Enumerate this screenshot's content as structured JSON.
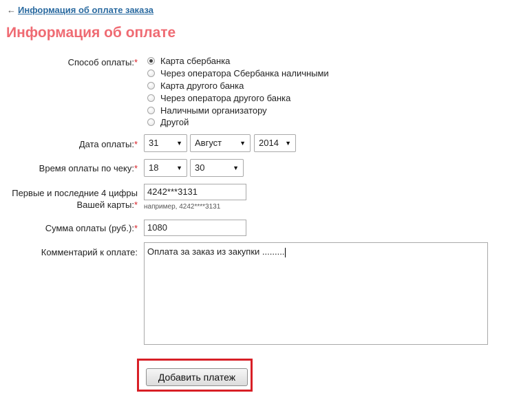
{
  "back_link": {
    "arrow": "←",
    "label": "Информация об оплате заказа"
  },
  "page_title": "Информация об оплате",
  "required_mark": "*",
  "payment_method": {
    "label": "Способ оплаты:",
    "options": [
      {
        "label": "Карта сбербанка",
        "checked": true
      },
      {
        "label": "Через оператора Сбербанка наличными",
        "checked": false
      },
      {
        "label": "Карта другого банка",
        "checked": false
      },
      {
        "label": "Через оператора другого банка",
        "checked": false
      },
      {
        "label": "Наличными организатору",
        "checked": false
      },
      {
        "label": "Другой",
        "checked": false
      }
    ]
  },
  "payment_date": {
    "label": "Дата оплаты:",
    "day": "31",
    "month": "Август",
    "year": "2014"
  },
  "payment_time": {
    "label": "Время оплаты по чеку:",
    "hour": "18",
    "minute": "30"
  },
  "card_digits": {
    "label_line1": "Первые и последние 4 цифры",
    "label_line2": "Вашей карты:",
    "value": "4242***3131",
    "hint": "например, 4242****3131"
  },
  "amount": {
    "label": "Сумма оплаты (руб.):",
    "value": "1080"
  },
  "comment": {
    "label": "Комментарий к оплате:",
    "value": "Оплата за заказ из закупки ........."
  },
  "submit": {
    "label": "Добавить платеж",
    "highlight_color": "#d81f26"
  },
  "colors": {
    "title": "#ef6b73",
    "link": "#2a6aa0",
    "required": "#d81f26"
  },
  "icons": {
    "select_caret": "▼"
  }
}
